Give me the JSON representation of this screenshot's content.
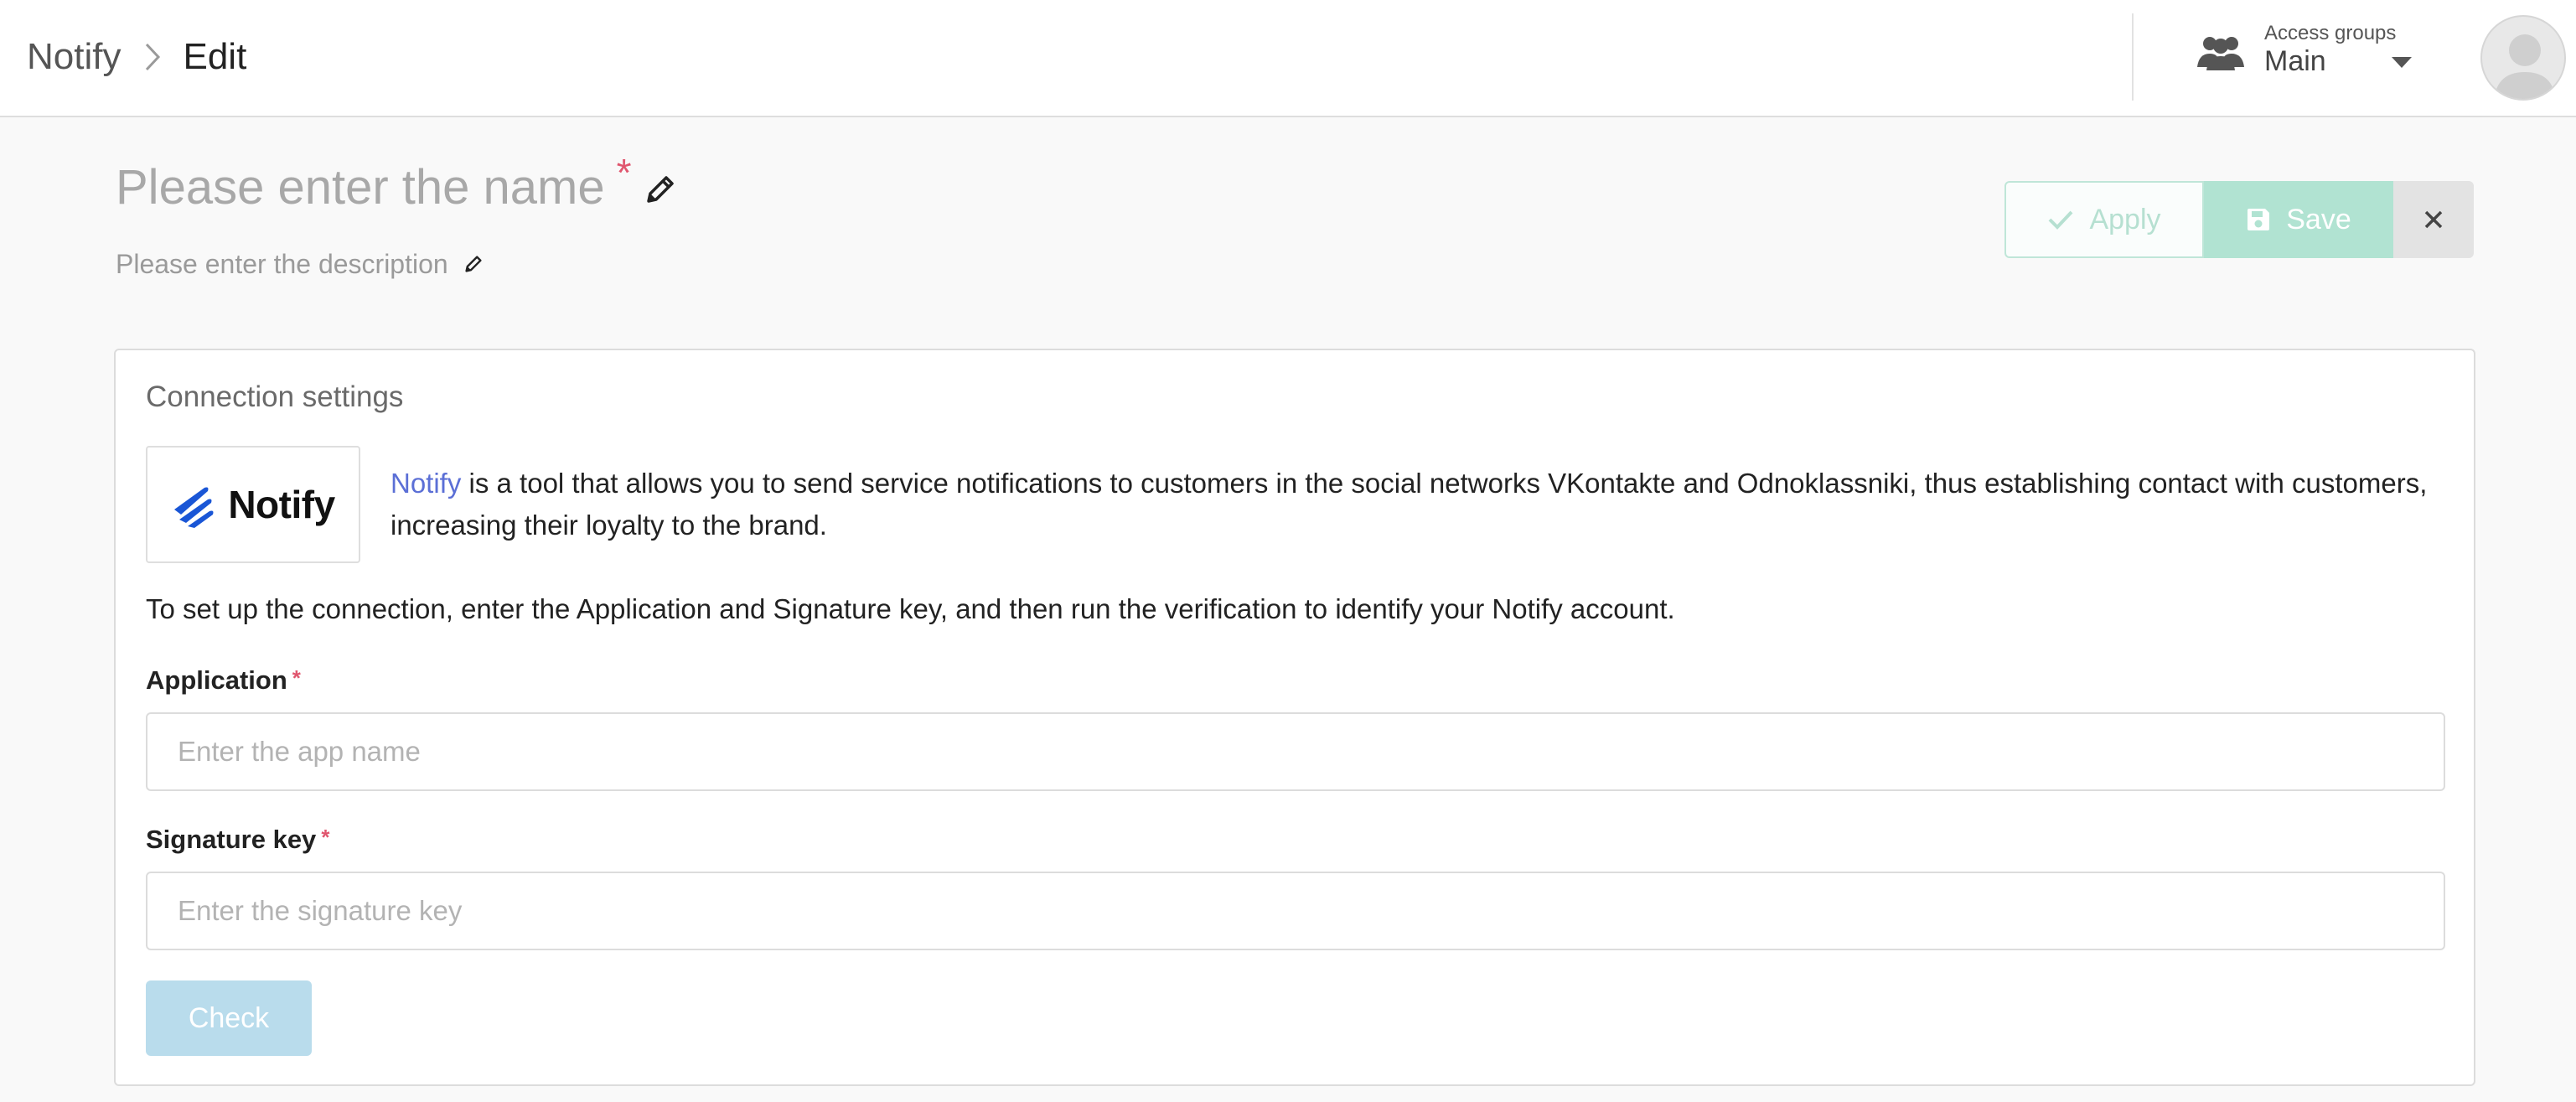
{
  "header": {
    "breadcrumb": {
      "root": "Notify",
      "current": "Edit"
    },
    "access_groups": {
      "label": "Access groups",
      "value": "Main"
    }
  },
  "title": {
    "name_placeholder": "Please enter the name",
    "required_mark": "*",
    "description_placeholder": "Please enter the description"
  },
  "actions": {
    "apply_label": "Apply",
    "save_label": "Save"
  },
  "connection": {
    "section_title": "Connection settings",
    "logo_text": "Notify",
    "intro_link": "Notify",
    "intro_text": " is a tool that allows you to send service notifications to customers in the social networks VKontakte and Odnoklassniki, thus establishing contact with customers, increasing their loyalty to the brand.",
    "instructions": "To set up the connection, enter the Application and Signature key, and then run the verification to identify your Notify account.",
    "application": {
      "label": "Application",
      "required_mark": "*",
      "placeholder": "Enter the app name",
      "value": ""
    },
    "signature": {
      "label": "Signature key",
      "required_mark": "*",
      "placeholder": "Enter the signature key",
      "value": ""
    },
    "check_label": "Check"
  },
  "colors": {
    "accent_link": "#5b6fd6",
    "required": "#e0566e",
    "save_bg": "#b1e3d2",
    "check_bg": "#b9dcec",
    "logo_blue": "#1a56d6"
  },
  "icons": {
    "breadcrumb_separator": "chevron-right-icon",
    "access_groups": "people-icon",
    "dropdown": "caret-down-icon",
    "avatar": "user-avatar-icon",
    "edit": "pencil-icon",
    "apply": "check-icon",
    "save": "floppy-disk-icon",
    "close": "close-icon",
    "logo": "notify-logo-icon"
  }
}
